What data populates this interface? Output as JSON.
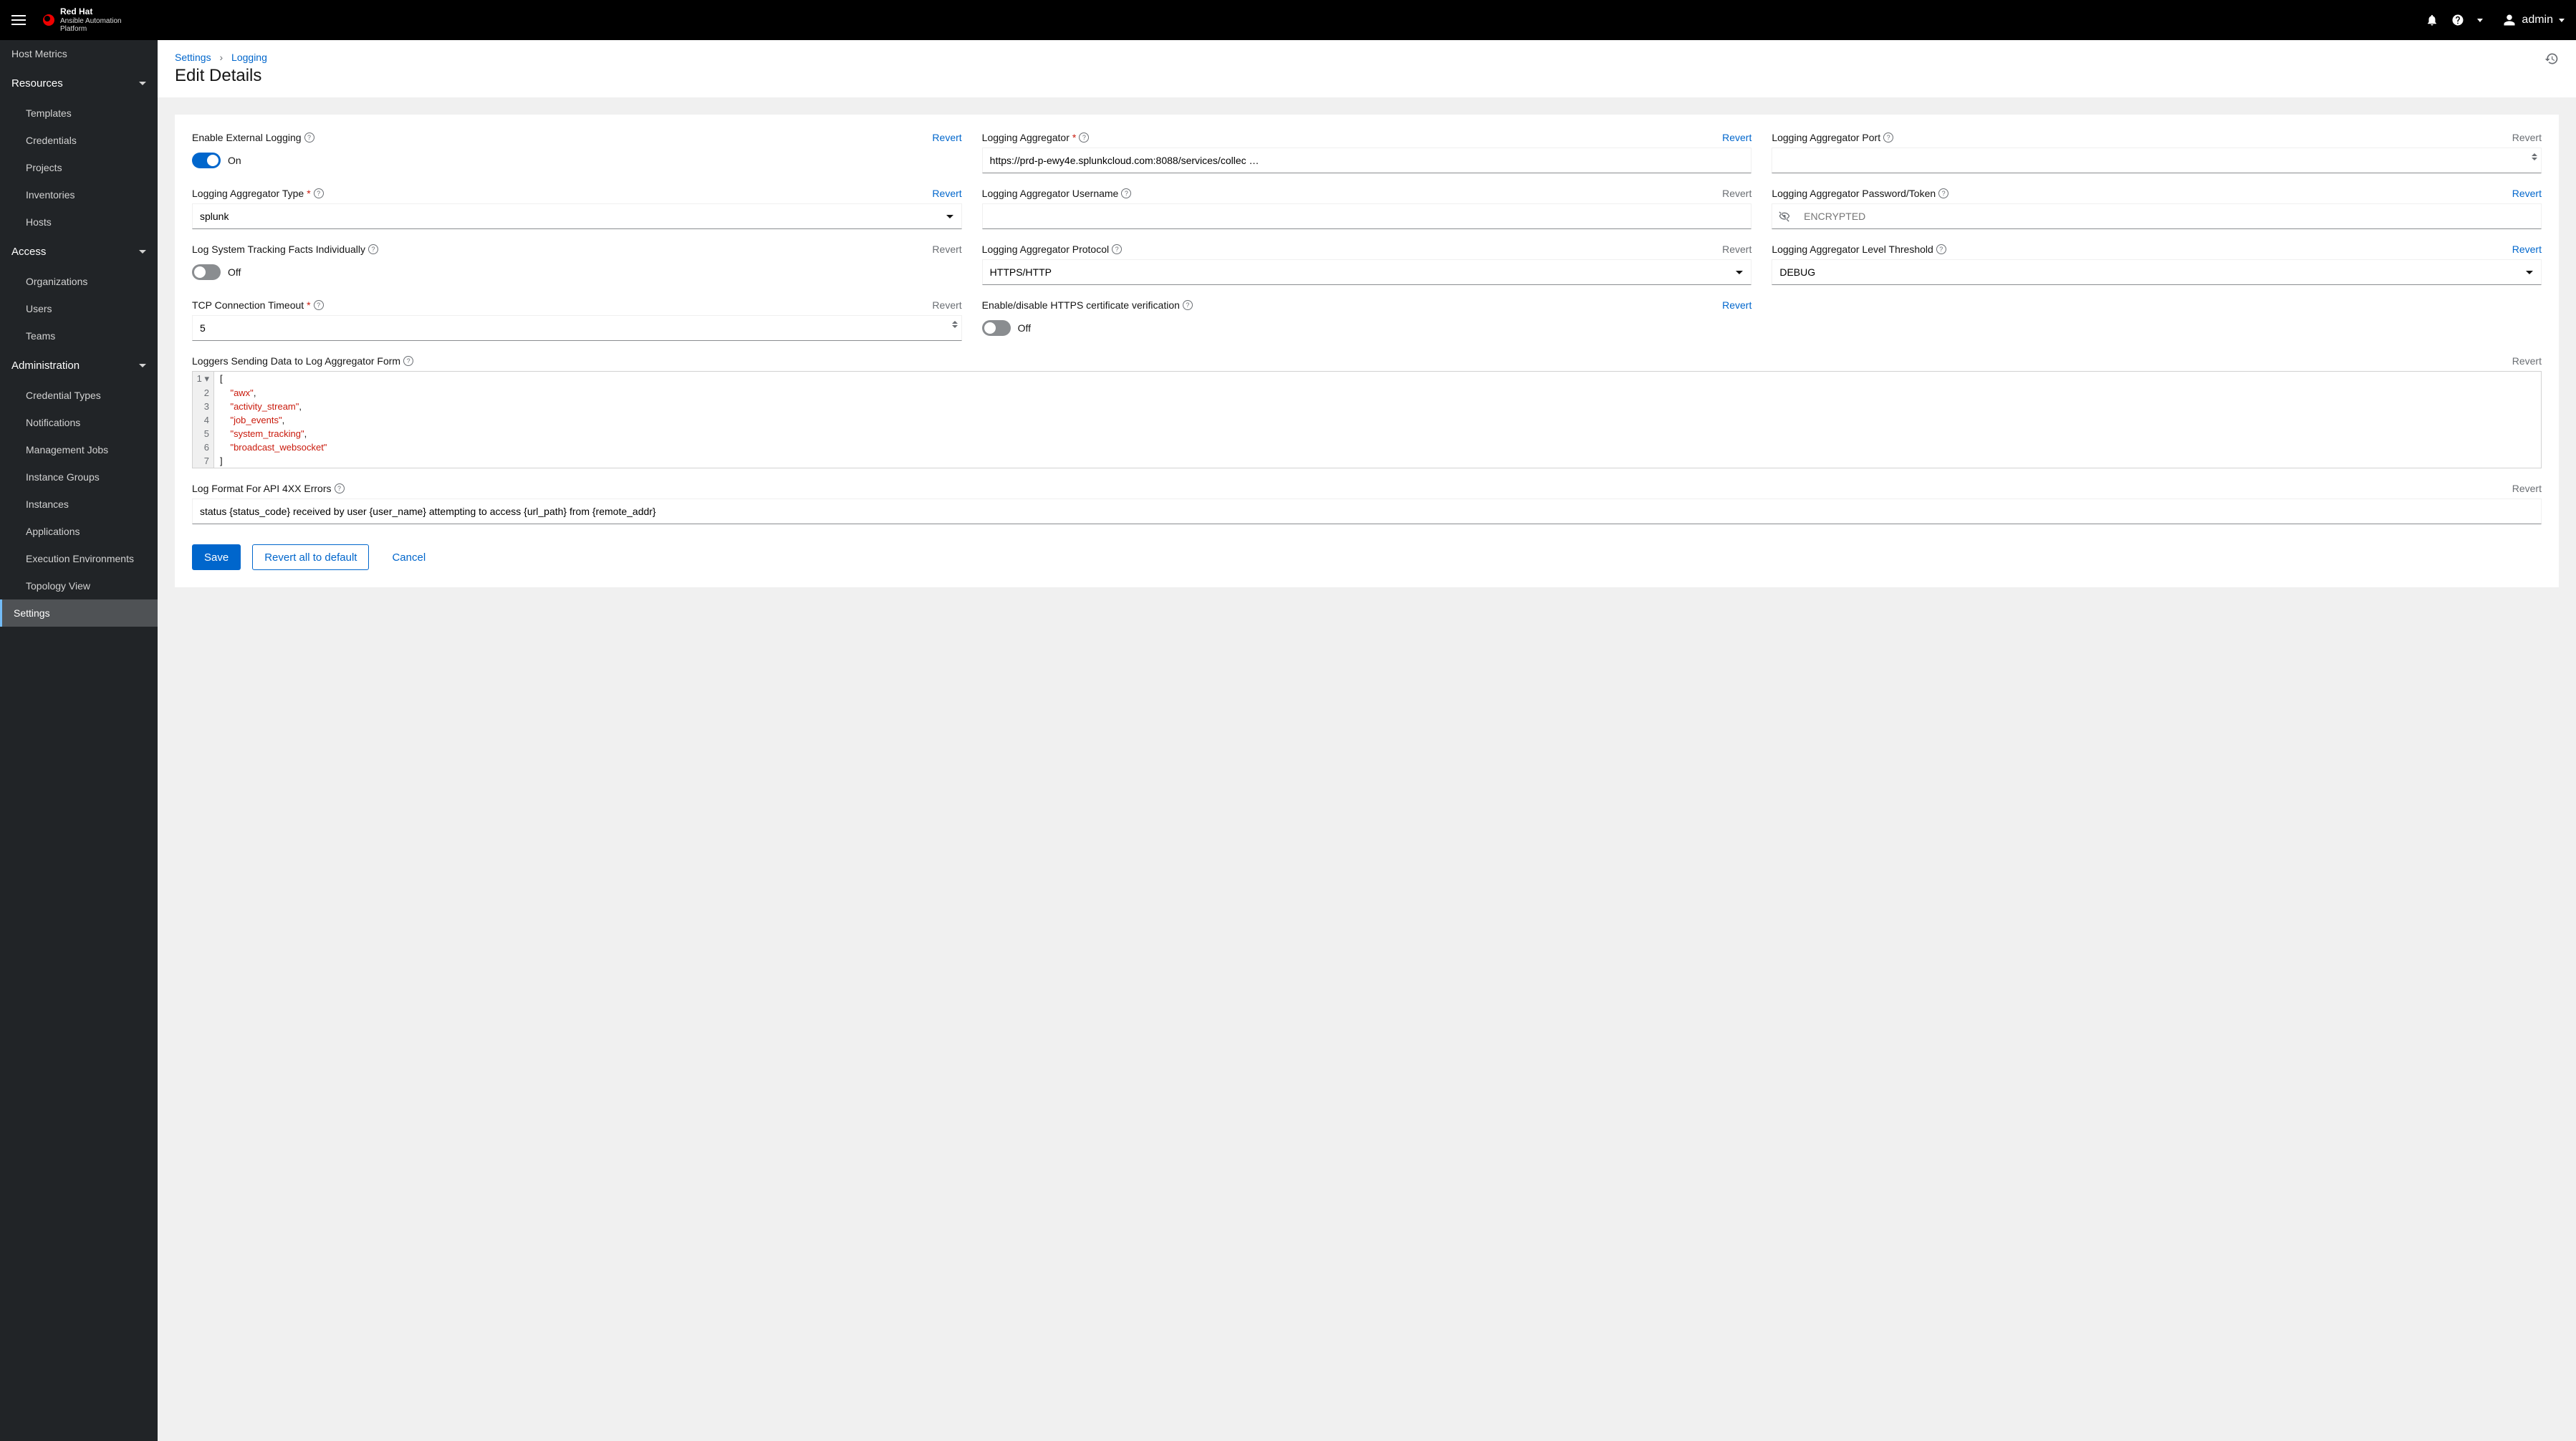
{
  "brand": {
    "line1": "Red Hat",
    "line2": "Ansible Automation",
    "line3": "Platform"
  },
  "top": {
    "username": "admin"
  },
  "sidebar": {
    "host_metrics": "Host Metrics",
    "resources": "Resources",
    "resources_items": [
      "Templates",
      "Credentials",
      "Projects",
      "Inventories",
      "Hosts"
    ],
    "access": "Access",
    "access_items": [
      "Organizations",
      "Users",
      "Teams"
    ],
    "administration": "Administration",
    "admin_items": [
      "Credential Types",
      "Notifications",
      "Management Jobs",
      "Instance Groups",
      "Instances",
      "Applications",
      "Execution Environments",
      "Topology View"
    ],
    "settings": "Settings"
  },
  "crumbs": {
    "settings": "Settings",
    "logging": "Logging",
    "sep": "›"
  },
  "page_title": "Edit Details",
  "labels": {
    "enable_ext": "Enable External Logging",
    "aggregator": "Logging Aggregator",
    "port": "Logging Aggregator Port",
    "type": "Logging Aggregator Type",
    "username": "Logging Aggregator Username",
    "password": "Logging Aggregator Password/Token",
    "track_facts": "Log System Tracking Facts Individually",
    "protocol": "Logging Aggregator Protocol",
    "threshold": "Logging Aggregator Level Threshold",
    "tcp_timeout": "TCP Connection Timeout",
    "https_verify": "Enable/disable HTTPS certificate verification",
    "loggers_form": "Loggers Sending Data to Log Aggregator Form",
    "log_format": "Log Format For API 4XX Errors",
    "on": "On",
    "off": "Off",
    "revert": "Revert",
    "encrypted": "ENCRYPTED"
  },
  "values": {
    "aggregator": "https://prd-p-ewy4e.splunkcloud.com:8088/services/collec …",
    "port": "",
    "type": "splunk",
    "username": "",
    "protocol": "HTTPS/HTTP",
    "threshold": "DEBUG",
    "tcp_timeout": "5",
    "log_format": "status {status_code} received by user {user_name} attempting to access {url_path} from {remote_addr}"
  },
  "loggers": [
    "awx",
    "activity_stream",
    "job_events",
    "system_tracking",
    "broadcast_websocket"
  ],
  "buttons": {
    "save": "Save",
    "revert_all": "Revert all to default",
    "cancel": "Cancel"
  }
}
